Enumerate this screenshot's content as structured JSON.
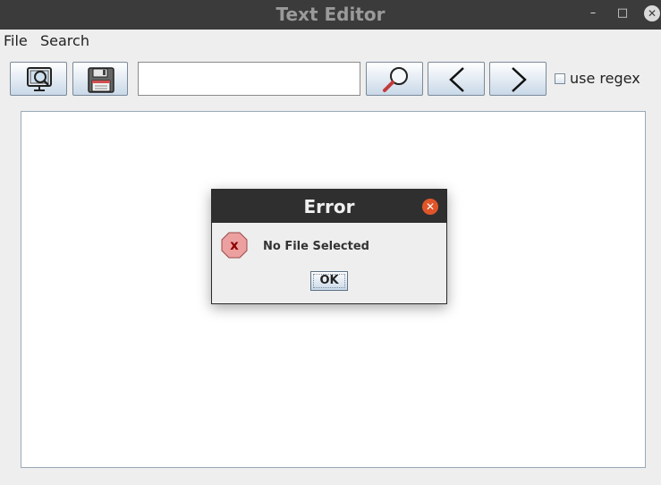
{
  "window": {
    "title": "Text Editor",
    "minimize_symbol": "–",
    "maximize_symbol": "□",
    "close_symbol": "✕"
  },
  "menu": {
    "items": [
      "File",
      "Search"
    ]
  },
  "toolbar": {
    "buttons": [
      {
        "name": "open-file-button",
        "icon": "open-file-icon"
      },
      {
        "name": "save-button",
        "icon": "floppy-disk-icon"
      },
      {
        "name": "search-button",
        "icon": "magnifier-icon"
      },
      {
        "name": "previous-button",
        "icon": "chevron-left-icon"
      },
      {
        "name": "next-button",
        "icon": "chevron-right-icon"
      }
    ],
    "search_value": "",
    "regex_checked": false,
    "regex_label": "use regex"
  },
  "editor": {
    "content": ""
  },
  "dialog": {
    "title": "Error",
    "close_symbol": "✕",
    "icon": "error-icon",
    "message": "No File Selected",
    "ok_label": "OK"
  },
  "colors": {
    "titlebar": "#3b3b3b",
    "dialog_titlebar": "#2f2f2f",
    "dialog_close": "#e0552a",
    "error_icon": "#e58a8a",
    "error_x": "#8b0000",
    "button_gradient_bottom": "#c9d8e8"
  }
}
